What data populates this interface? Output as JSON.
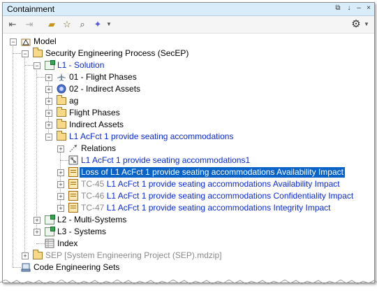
{
  "window": {
    "title": "Containment"
  },
  "titlebar_icons": [
    "restore-icon",
    "pin-icon",
    "minimize-icon",
    "close-icon"
  ],
  "toolbar_icons": [
    "collapse-all-icon",
    "expand-icon",
    "open-folder-icon",
    "star-icon",
    "search-icon",
    "sparkle-icon",
    "dropdown-icon",
    "gear-icon"
  ],
  "tree": [
    {
      "label": "Model",
      "color": "#000000"
    },
    {
      "label": "Security Engineering Process (SecEP)",
      "color": "#000000"
    },
    {
      "label": "L1 - Solution",
      "color": "#0b2bd1"
    },
    {
      "label": "01 - Flight Phases",
      "color": "#000000"
    },
    {
      "label": "02 - Indirect Assets",
      "color": "#000000"
    },
    {
      "label": "ag",
      "color": "#000000"
    },
    {
      "label": "Flight Phases",
      "color": "#000000"
    },
    {
      "label": "Indirect Assets",
      "color": "#000000"
    },
    {
      "label": "L1 AcFct 1 provide seating accommodations",
      "color": "#0b2bd1"
    },
    {
      "label": "Relations",
      "color": "#000000"
    },
    {
      "label": "L1 AcFct 1 provide seating accommodations1",
      "color": "#0b2bd1"
    },
    {
      "label": "Loss of L1 AcFct 1 provide seating accommodations Availability Impact",
      "selected": true
    },
    {
      "prefix": "TC-45 ",
      "label": "L1 AcFct 1 provide seating accommodations Availability Impact",
      "color": "#0b2bd1"
    },
    {
      "prefix": "TC-46 ",
      "label": "L1 AcFct 1 provide seating accommodations Confidentiality Impact",
      "color": "#0b2bd1"
    },
    {
      "prefix": "TC-47 ",
      "label": "L1 AcFct 1 provide seating accommodations Integrity Impact",
      "color": "#0b2bd1"
    },
    {
      "label": "L2 - Multi-Systems",
      "color": "#000000"
    },
    {
      "label": "L3 - Systems",
      "color": "#000000"
    },
    {
      "label": "Index",
      "color": "#000000"
    },
    {
      "label": "SEP [System Engineering Project (SEP).mdzip]",
      "color": "#8a8a8a"
    },
    {
      "label": "Code Engineering Sets",
      "color": "#000000"
    }
  ]
}
